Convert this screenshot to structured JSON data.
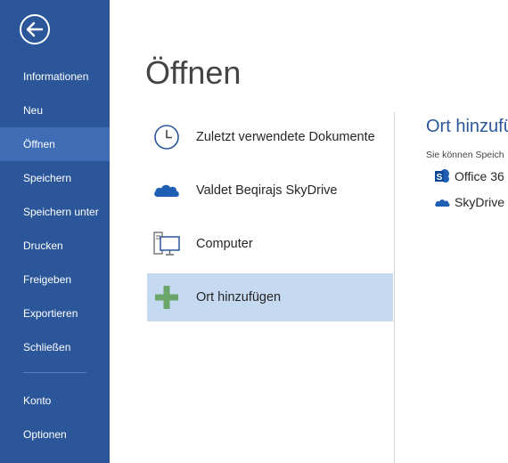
{
  "sidebar": {
    "back_icon": "back-arrow-icon",
    "items": [
      {
        "label": "Informationen"
      },
      {
        "label": "Neu"
      },
      {
        "label": "Öffnen",
        "active": true
      },
      {
        "label": "Speichern"
      },
      {
        "label": "Speichern unter"
      },
      {
        "label": "Drucken"
      },
      {
        "label": "Freigeben"
      },
      {
        "label": "Exportieren"
      },
      {
        "label": "Schließen"
      },
      {
        "label": "Konto"
      },
      {
        "label": "Optionen"
      }
    ]
  },
  "main": {
    "title": "Öffnen",
    "places": [
      {
        "label": "Zuletzt verwendete Dokumente",
        "icon": "clock-icon"
      },
      {
        "label": "Valdet Beqirajs SkyDrive",
        "icon": "cloud-icon"
      },
      {
        "label": "Computer",
        "icon": "computer-icon"
      },
      {
        "label": "Ort hinzufügen",
        "icon": "plus-icon",
        "selected": true
      }
    ]
  },
  "right_panel": {
    "title": "Ort hinzufü",
    "subtitle": "Sie können Speich",
    "services": [
      {
        "label": "Office 36",
        "icon": "sharepoint-icon"
      },
      {
        "label": "SkyDrive",
        "icon": "skydrive-icon"
      }
    ]
  },
  "colors": {
    "sidebar": "#2b579a",
    "sidebar_active": "#3e6db5",
    "selected_place": "#c5d9f1",
    "accent": "#2b579a"
  }
}
